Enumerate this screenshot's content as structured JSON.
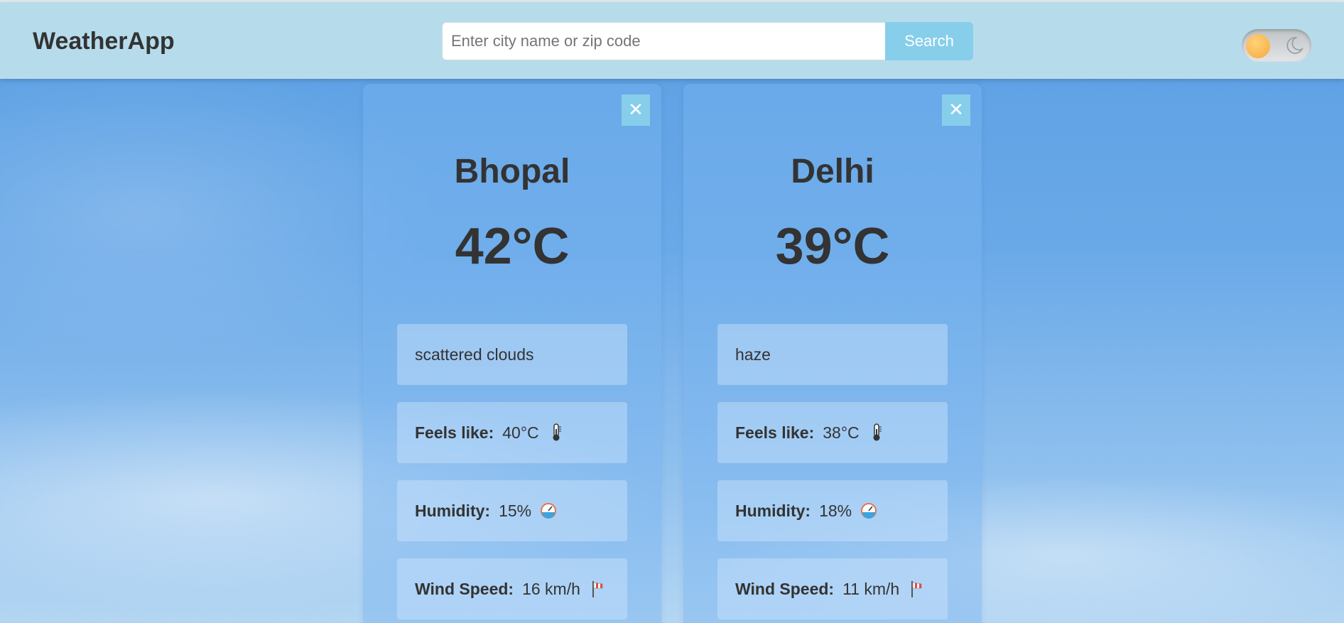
{
  "app": {
    "title": "WeatherApp"
  },
  "search": {
    "placeholder": "Enter city name or zip code",
    "value": "",
    "button_label": "Search"
  },
  "theme_toggle": {
    "state": "light",
    "icons": [
      "sun-icon",
      "moon-icon"
    ]
  },
  "labels": {
    "feels_like": "Feels like:",
    "humidity": "Humidity:",
    "wind_speed": "Wind Speed:",
    "close": "✕"
  },
  "cards": [
    {
      "city": "Bhopal",
      "temperature": "42°C",
      "description": "scattered clouds",
      "feels_like": "40°C",
      "humidity": "15%",
      "wind_speed": "16 km/h"
    },
    {
      "city": "Delhi",
      "temperature": "39°C",
      "description": "haze",
      "feels_like": "38°C",
      "humidity": "18%",
      "wind_speed": "11 km/h"
    }
  ],
  "colors": {
    "header_bg": "#b6dcec",
    "accent": "#87ceeb",
    "text": "#333333"
  }
}
